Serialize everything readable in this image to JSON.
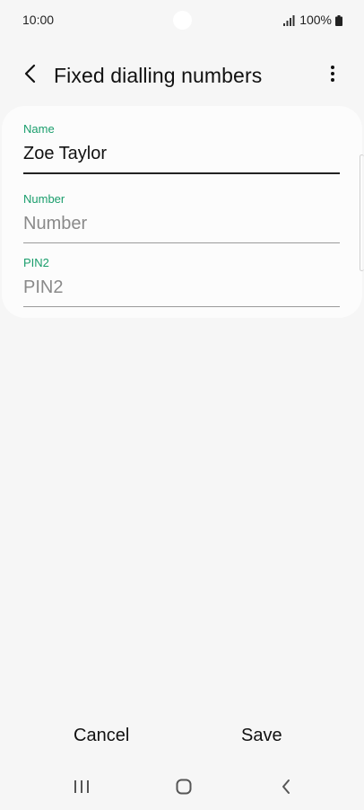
{
  "status_bar": {
    "time": "10:00",
    "battery": "100%",
    "icons": [
      "signal-icon",
      "battery-icon"
    ]
  },
  "header": {
    "title": "Fixed dialling numbers",
    "back_icon": "chevron-left-icon",
    "more_icon": "more-vertical-icon"
  },
  "form": {
    "name": {
      "label": "Name",
      "value": "Zoe Taylor",
      "placeholder": ""
    },
    "number": {
      "label": "Number",
      "value": "",
      "placeholder": "Number"
    },
    "pin2": {
      "label": "PIN2",
      "value": "",
      "placeholder": "PIN2"
    }
  },
  "actions": {
    "cancel_label": "Cancel",
    "save_label": "Save"
  },
  "nav": {
    "icons": [
      "recents-icon",
      "home-icon",
      "back-icon"
    ]
  },
  "colors": {
    "accent": "#1a9e6c",
    "background": "#f6f6f6",
    "card": "#fcfcfc"
  }
}
